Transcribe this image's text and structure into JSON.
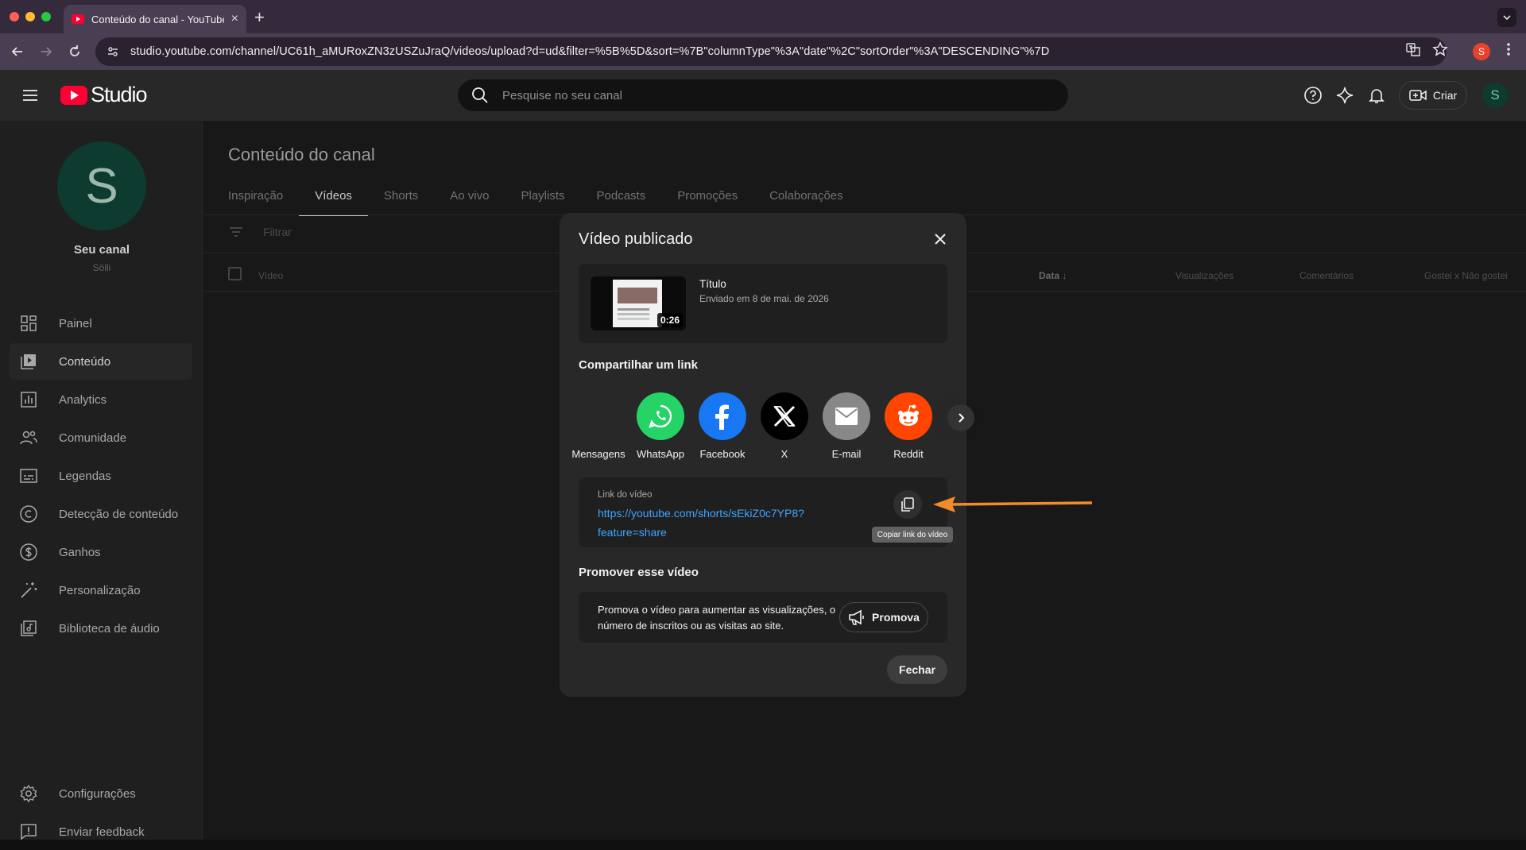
{
  "browser": {
    "tab_title": "Conteúdo do canal - YouTube Studio",
    "tab_close": "×",
    "new_tab": "+",
    "url": "studio.youtube.com/channel/UC61h_aMURoxZN3zUSZuJraQ/videos/upload?d=ud&filter=%5B%5D&sort=%7B\"columnType\"%3A\"date\"%2C\"sortOrder\"%3A\"DESCENDING\"%7D",
    "profile_initial": "S",
    "colors": {
      "tabbar": "#35293c",
      "toolbar": "#4a3f52"
    }
  },
  "header": {
    "logo_text": "Studio",
    "search_placeholder": "Pesquise no seu canal",
    "create_label": "Criar",
    "avatar_initial": "S"
  },
  "sidebar": {
    "avatar_initial": "S",
    "channel_name": "Seu canal",
    "channel_handle": "Sölli",
    "items": [
      {
        "label": "Painel",
        "icon": "dashboard-icon"
      },
      {
        "label": "Conteúdo",
        "icon": "content-icon",
        "active": true
      },
      {
        "label": "Analytics",
        "icon": "analytics-icon"
      },
      {
        "label": "Comunidade",
        "icon": "community-icon"
      },
      {
        "label": "Legendas",
        "icon": "subtitles-icon"
      },
      {
        "label": "Detecção de conteúdo",
        "icon": "copyright-icon"
      },
      {
        "label": "Ganhos",
        "icon": "earn-icon"
      },
      {
        "label": "Personalização",
        "icon": "customization-icon"
      },
      {
        "label": "Biblioteca de áudio",
        "icon": "audio-library-icon"
      }
    ],
    "bottom_items": [
      {
        "label": "Configurações",
        "icon": "settings-icon"
      },
      {
        "label": "Enviar feedback",
        "icon": "feedback-icon"
      }
    ]
  },
  "main": {
    "title": "Conteúdo do canal",
    "tabs": [
      "Inspiração",
      "Vídeos",
      "Shorts",
      "Ao vivo",
      "Playlists",
      "Podcasts",
      "Promoções",
      "Colaborações"
    ],
    "active_tab": "Vídeos",
    "filter_placeholder": "Filtrar",
    "columns": [
      "Vídeo",
      "Data",
      "Visualizações",
      "Comentários",
      "Gostei x Não gostei"
    ]
  },
  "modal": {
    "title": "Vídeo publicado",
    "video": {
      "title": "Título",
      "uploaded": "Enviado em 8 de mai. de 2026",
      "duration": "0:26"
    },
    "share_title": "Compartilhar um link",
    "share_targets": [
      {
        "label": "Mensagens",
        "icon": "messages-icon"
      },
      {
        "label": "WhatsApp",
        "icon": "whatsapp-icon",
        "color": "#25d366"
      },
      {
        "label": "Facebook",
        "icon": "facebook-icon",
        "color": "#1877f2"
      },
      {
        "label": "X",
        "icon": "x-icon",
        "color": "#000000"
      },
      {
        "label": "E-mail",
        "icon": "email-icon",
        "color": "#888888"
      },
      {
        "label": "Reddit",
        "icon": "reddit-icon",
        "color": "#ff4500"
      }
    ],
    "link_label": "Link do vídeo",
    "link_url": "https://youtube.com/shorts/sEkiZ0c7YP8?feature=share",
    "copy_tooltip": "Copiar link do vídeo",
    "promote_title": "Promover esse vídeo",
    "promote_text": "Promova o vídeo para aumentar as visualizações, o número de inscritos ou as visitas ao site.",
    "promote_button": "Promova",
    "close_button": "Fechar"
  },
  "annotation": {
    "arrow_color": "#f28c28"
  }
}
